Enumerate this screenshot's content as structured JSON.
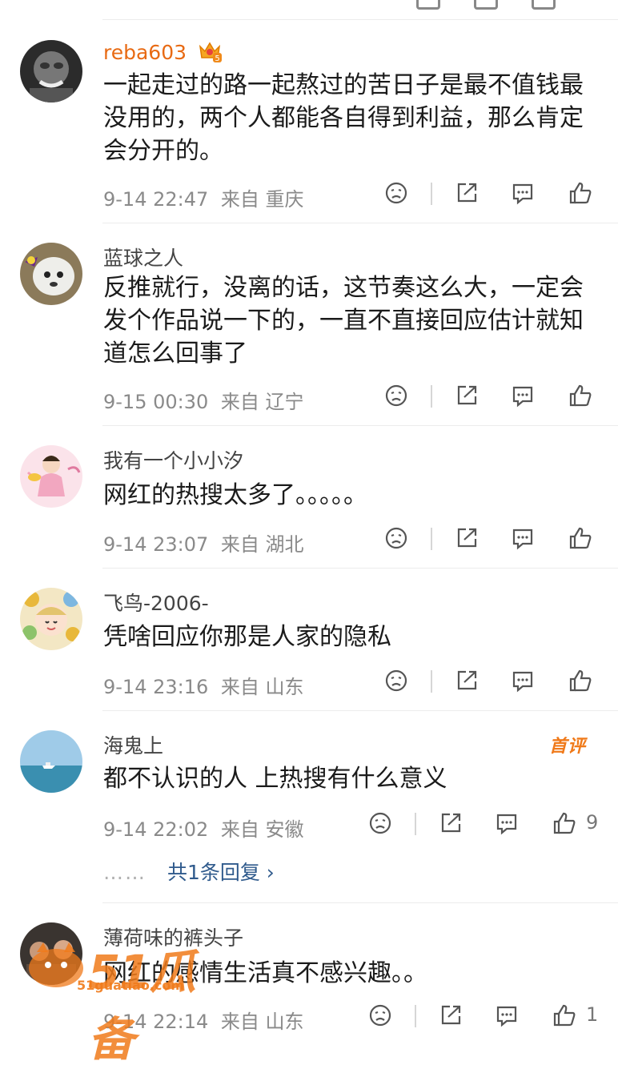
{
  "comments": [
    {
      "username": "reba603",
      "vip_level": "5",
      "text": "一起走过的路一起熬过的苦日子是最不值钱最没用的，两个人都能各自得到利益，那么肯定会分开的。",
      "time": "9-14 22:47",
      "source": "来自 重庆"
    },
    {
      "username": "蓝球之人",
      "text": "反推就行，没离的话，这节奏这么大，一定会发个作品说一下的，一直不直接回应估计就知道怎么回事了",
      "time": "9-15 00:30",
      "source": "来自 辽宁"
    },
    {
      "username": "我有一个小小汐",
      "text": "网红的热搜太多了。。。。。",
      "time": "9-14 23:07",
      "source": "来自 湖北"
    },
    {
      "username": "飞鸟-2006-",
      "text": "凭啥回应你那是人家的隐私",
      "time": "9-14 23:16",
      "source": "来自 山东"
    },
    {
      "username": "海鬼上",
      "badge": "首评",
      "text": "都不认识的人 上热搜有什么意义",
      "time": "9-14 22:02",
      "source": "来自 安徽",
      "likes": "9",
      "replies_dots": "……",
      "replies_link": "共1条回复 ›"
    },
    {
      "username": "薄荷味的裤头子",
      "text": "网红的感情生活真不感兴趣。。",
      "time": "9-14 22:14",
      "source": "来自 山东",
      "likes": "1"
    }
  ],
  "watermark": {
    "text": "51瓜备",
    "url": "51guatiao.com"
  },
  "colors": {
    "vip_name": "#e86a13",
    "badge": "#f07a1a",
    "reply_link": "#2f5a8c",
    "meta": "#8a8a8a"
  },
  "icons": [
    "dislike-icon",
    "share-icon",
    "comment-icon",
    "like-icon"
  ]
}
